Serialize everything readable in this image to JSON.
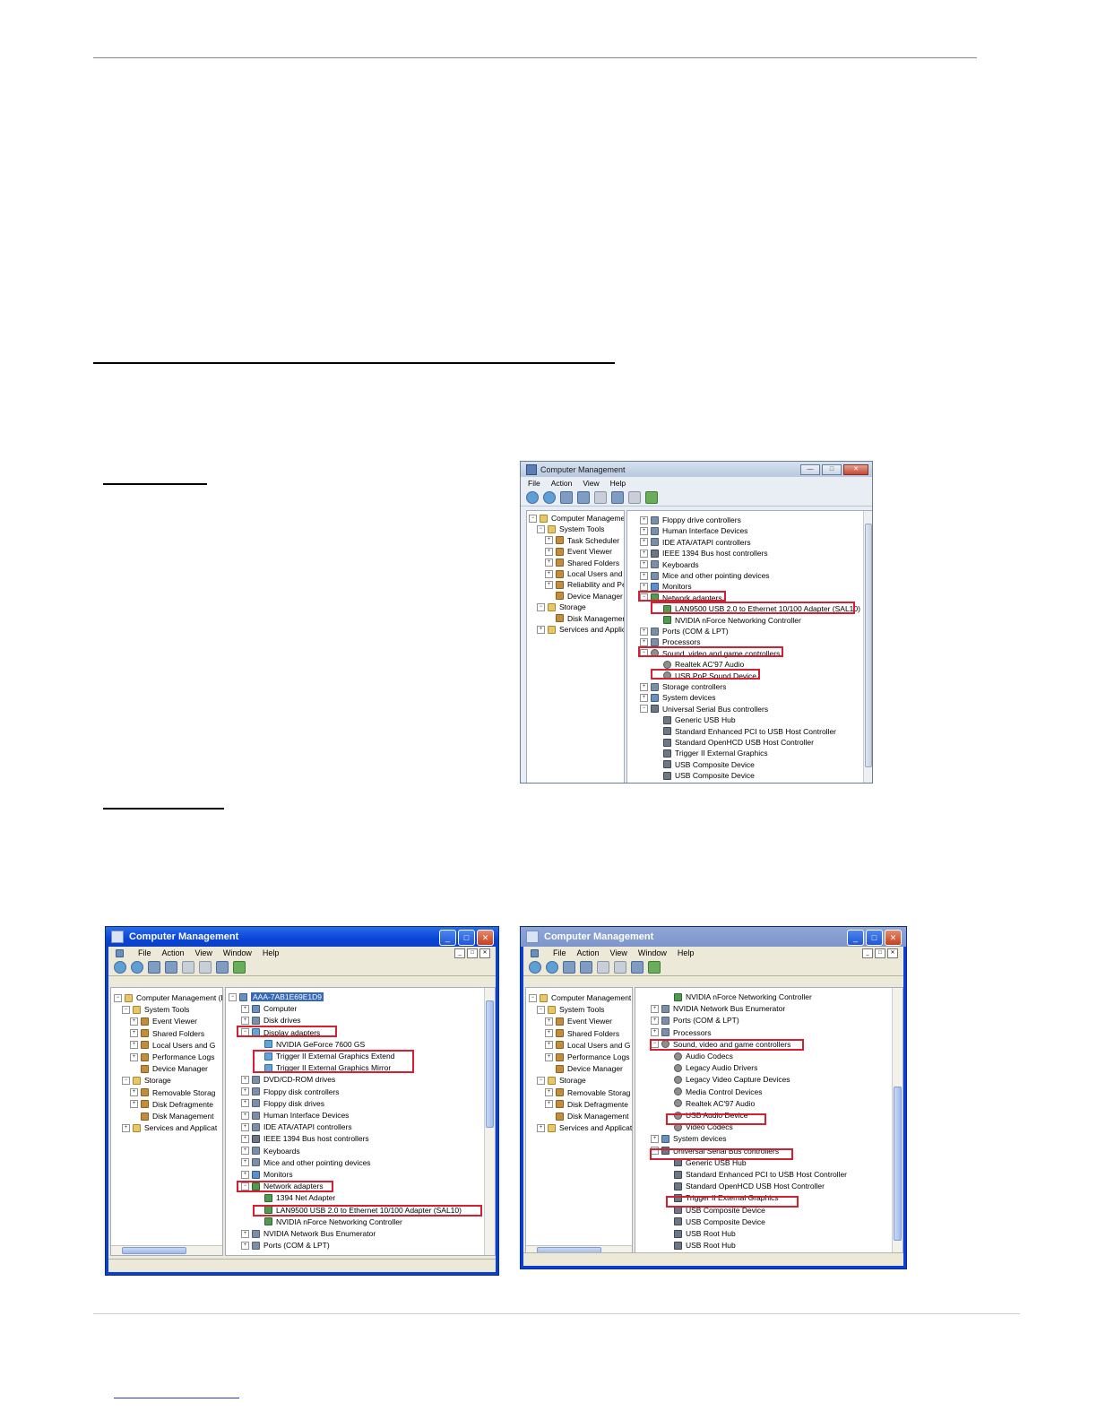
{
  "vista": {
    "title": "Computer Management",
    "menu": [
      "File",
      "Action",
      "View",
      "Help"
    ],
    "left_tree": [
      {
        "label": "Computer Management",
        "level": 0
      },
      {
        "label": "System Tools",
        "level": 1
      },
      {
        "label": "Task Scheduler",
        "level": 2
      },
      {
        "label": "Event Viewer",
        "level": 2
      },
      {
        "label": "Shared Folders",
        "level": 2
      },
      {
        "label": "Local Users and G",
        "level": 2
      },
      {
        "label": "Reliability and Pe",
        "level": 2
      },
      {
        "label": "Device Manager",
        "level": 2
      },
      {
        "label": "Storage",
        "level": 1
      },
      {
        "label": "Disk Managemen",
        "level": 2
      },
      {
        "label": "Services and Applicat",
        "level": 1
      }
    ],
    "right_tree": [
      {
        "label": "Floppy drive controllers",
        "level": 0,
        "icon": "ico"
      },
      {
        "label": "Human Interface Devices",
        "level": 0,
        "icon": "ico"
      },
      {
        "label": "IDE ATA/ATAPI controllers",
        "level": 0,
        "icon": "ico"
      },
      {
        "label": "IEEE 1394 Bus host controllers",
        "level": 0,
        "icon": "usb"
      },
      {
        "label": "Keyboards",
        "level": 0,
        "icon": "ico"
      },
      {
        "label": "Mice and other pointing devices",
        "level": 0,
        "icon": "ico"
      },
      {
        "label": "Monitors",
        "level": 0,
        "icon": "mon"
      },
      {
        "label": "Network adapters",
        "level": 0,
        "icon": "net"
      },
      {
        "label": "LAN9500 USB 2.0 to Ethernet 10/100 Adapter (SAL10)",
        "level": 1,
        "icon": "net"
      },
      {
        "label": "NVIDIA nForce Networking Controller",
        "level": 1,
        "icon": "net"
      },
      {
        "label": "Ports (COM & LPT)",
        "level": 0,
        "icon": "ico"
      },
      {
        "label": "Processors",
        "level": 0,
        "icon": "ico"
      },
      {
        "label": "Sound, video and game controllers",
        "level": 0,
        "icon": "snd"
      },
      {
        "label": "Realtek AC'97 Audio",
        "level": 1,
        "icon": "snd"
      },
      {
        "label": "USB PnP Sound Device",
        "level": 1,
        "icon": "snd"
      },
      {
        "label": "Storage controllers",
        "level": 0,
        "icon": "ico"
      },
      {
        "label": "System devices",
        "level": 0,
        "icon": "pc"
      },
      {
        "label": "Universal Serial Bus controllers",
        "level": 0,
        "icon": "usb"
      },
      {
        "label": "Generic USB Hub",
        "level": 1,
        "icon": "usb"
      },
      {
        "label": "Standard Enhanced PCI to USB Host Controller",
        "level": 1,
        "icon": "usb"
      },
      {
        "label": "Standard OpenHCD USB Host Controller",
        "level": 1,
        "icon": "usb"
      },
      {
        "label": "Trigger II External Graphics",
        "level": 1,
        "icon": "usb"
      },
      {
        "label": "USB Composite Device",
        "level": 1,
        "icon": "usb"
      },
      {
        "label": "USB Composite Device",
        "level": 1,
        "icon": "usb"
      }
    ]
  },
  "xp1": {
    "title": "Computer Management",
    "menu": [
      "File",
      "Action",
      "View",
      "Window",
      "Help"
    ],
    "left_tree": [
      {
        "label": "Computer Management (L",
        "level": 0
      },
      {
        "label": "System Tools",
        "level": 1
      },
      {
        "label": "Event Viewer",
        "level": 2
      },
      {
        "label": "Shared Folders",
        "level": 2
      },
      {
        "label": "Local Users and G",
        "level": 2
      },
      {
        "label": "Performance Logs",
        "level": 2
      },
      {
        "label": "Device Manager",
        "level": 2
      },
      {
        "label": "Storage",
        "level": 1
      },
      {
        "label": "Removable Storag",
        "level": 2
      },
      {
        "label": "Disk Defragmente",
        "level": 2
      },
      {
        "label": "Disk Management",
        "level": 2
      },
      {
        "label": "Services and Applicat",
        "level": 1
      }
    ],
    "right_tree": [
      {
        "label": "AAA-7AB1E69E1D9",
        "level": 0,
        "icon": "pc"
      },
      {
        "label": "Computer",
        "level": 1,
        "icon": "pc"
      },
      {
        "label": "Disk drives",
        "level": 1,
        "icon": "ico"
      },
      {
        "label": "Display adapters",
        "level": 1,
        "icon": "disp"
      },
      {
        "label": "NVIDIA GeForce 7600 GS",
        "level": 2,
        "icon": "disp"
      },
      {
        "label": "Trigger II External Graphics Extend",
        "level": 2,
        "icon": "disp"
      },
      {
        "label": "Trigger II External Graphics Mirror",
        "level": 2,
        "icon": "disp"
      },
      {
        "label": "DVD/CD-ROM drives",
        "level": 1,
        "icon": "ico"
      },
      {
        "label": "Floppy disk controllers",
        "level": 1,
        "icon": "ico"
      },
      {
        "label": "Floppy disk drives",
        "level": 1,
        "icon": "ico"
      },
      {
        "label": "Human Interface Devices",
        "level": 1,
        "icon": "ico"
      },
      {
        "label": "IDE ATA/ATAPI controllers",
        "level": 1,
        "icon": "ico"
      },
      {
        "label": "IEEE 1394 Bus host controllers",
        "level": 1,
        "icon": "usb"
      },
      {
        "label": "Keyboards",
        "level": 1,
        "icon": "ico"
      },
      {
        "label": "Mice and other pointing devices",
        "level": 1,
        "icon": "ico"
      },
      {
        "label": "Monitors",
        "level": 1,
        "icon": "mon"
      },
      {
        "label": "Network adapters",
        "level": 1,
        "icon": "net"
      },
      {
        "label": "1394 Net Adapter",
        "level": 2,
        "icon": "net"
      },
      {
        "label": "LAN9500 USB 2.0 to Ethernet 10/100 Adapter (SAL10)",
        "level": 2,
        "icon": "net"
      },
      {
        "label": "NVIDIA nForce Networking Controller",
        "level": 2,
        "icon": "net"
      },
      {
        "label": "NVIDIA Network Bus Enumerator",
        "level": 1,
        "icon": "ico"
      },
      {
        "label": "Ports (COM & LPT)",
        "level": 1,
        "icon": "ico"
      }
    ]
  },
  "xp2": {
    "title": "Computer Management",
    "menu": [
      "File",
      "Action",
      "View",
      "Window",
      "Help"
    ],
    "left_tree": [
      {
        "label": "Computer Management (L",
        "level": 0
      },
      {
        "label": "System Tools",
        "level": 1
      },
      {
        "label": "Event Viewer",
        "level": 2
      },
      {
        "label": "Shared Folders",
        "level": 2
      },
      {
        "label": "Local Users and G",
        "level": 2
      },
      {
        "label": "Performance Logs",
        "level": 2
      },
      {
        "label": "Device Manager",
        "level": 2
      },
      {
        "label": "Storage",
        "level": 1
      },
      {
        "label": "Removable Storag",
        "level": 2
      },
      {
        "label": "Disk Defragmente",
        "level": 2
      },
      {
        "label": "Disk Management",
        "level": 2
      },
      {
        "label": "Services and Applicat",
        "level": 1
      }
    ],
    "right_tree": [
      {
        "label": "NVIDIA nForce Networking Controller",
        "level": 2,
        "icon": "net"
      },
      {
        "label": "NVIDIA Network Bus Enumerator",
        "level": 1,
        "icon": "ico"
      },
      {
        "label": "Ports (COM & LPT)",
        "level": 1,
        "icon": "ico"
      },
      {
        "label": "Processors",
        "level": 1,
        "icon": "ico"
      },
      {
        "label": "Sound, video and game controllers",
        "level": 1,
        "icon": "snd"
      },
      {
        "label": "Audio Codecs",
        "level": 2,
        "icon": "snd"
      },
      {
        "label": "Legacy Audio Drivers",
        "level": 2,
        "icon": "snd"
      },
      {
        "label": "Legacy Video Capture Devices",
        "level": 2,
        "icon": "snd"
      },
      {
        "label": "Media Control Devices",
        "level": 2,
        "icon": "snd"
      },
      {
        "label": "Realtek AC'97 Audio",
        "level": 2,
        "icon": "snd"
      },
      {
        "label": "USB Audio Device",
        "level": 2,
        "icon": "snd"
      },
      {
        "label": "Video Codecs",
        "level": 2,
        "icon": "snd"
      },
      {
        "label": "System devices",
        "level": 1,
        "icon": "pc"
      },
      {
        "label": "Universal Serial Bus controllers",
        "level": 1,
        "icon": "usb"
      },
      {
        "label": "Generic USB Hub",
        "level": 2,
        "icon": "usb"
      },
      {
        "label": "Standard Enhanced PCI to USB Host Controller",
        "level": 2,
        "icon": "usb"
      },
      {
        "label": "Standard OpenHCD USB Host Controller",
        "level": 2,
        "icon": "usb"
      },
      {
        "label": "Trigger II External Graphics",
        "level": 2,
        "icon": "usb"
      },
      {
        "label": "USB Composite Device",
        "level": 2,
        "icon": "usb"
      },
      {
        "label": "USB Composite Device",
        "level": 2,
        "icon": "usb"
      },
      {
        "label": "USB Root Hub",
        "level": 2,
        "icon": "usb"
      },
      {
        "label": "USB Root Hub",
        "level": 2,
        "icon": "usb"
      }
    ]
  }
}
